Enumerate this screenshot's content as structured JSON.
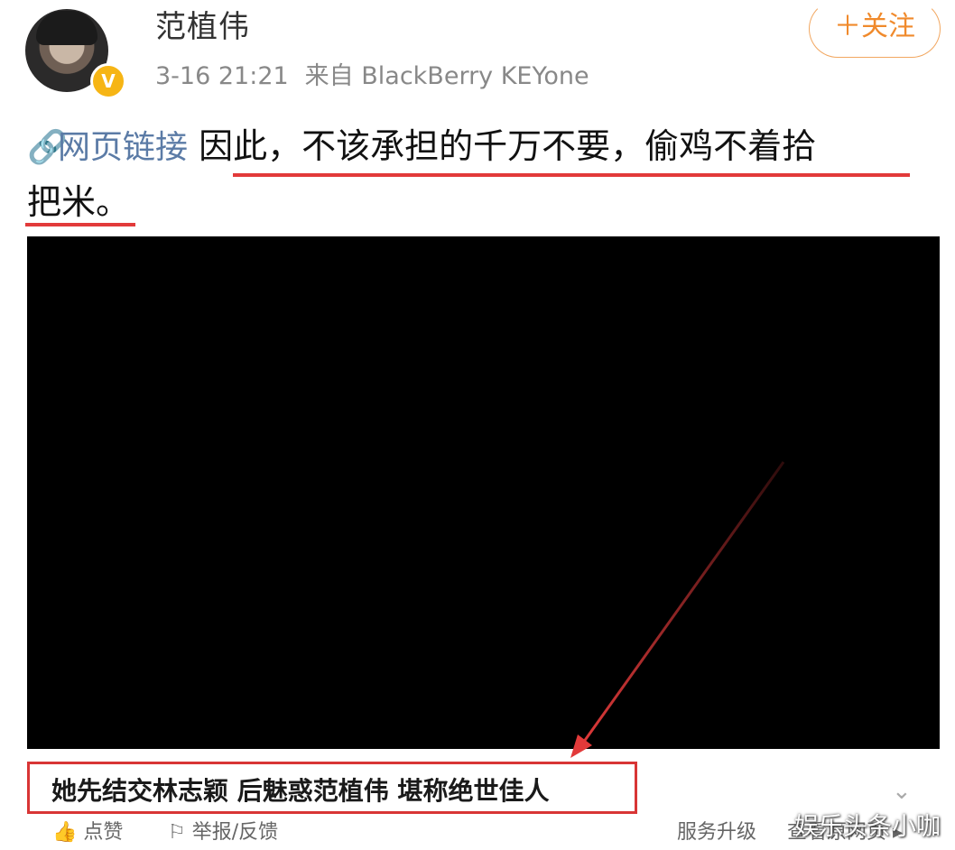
{
  "post": {
    "author": "范植伟",
    "verified_icon": "verified-v-badge",
    "time": "3-16 21:21",
    "source": "来自 BlackBerry KEYone",
    "follow_label": "＋关注",
    "link_label": "网页链接",
    "text_line1": "因此，不该承担的千万不要，偷鸡不着拾",
    "text_line2": "把米。"
  },
  "card": {
    "caption": "她先结交林志颖 后魅惑范植伟 堪称绝世佳人"
  },
  "actions": {
    "like": "点赞",
    "report": "举报/反馈",
    "upgrade": "服务升级",
    "view_original": "查看原网页"
  },
  "watermark": "娱乐头条小咖",
  "colors": {
    "accent_orange": "#f08a2c",
    "link_blue": "#5b7ba6",
    "highlight_red": "#e23a3a"
  }
}
